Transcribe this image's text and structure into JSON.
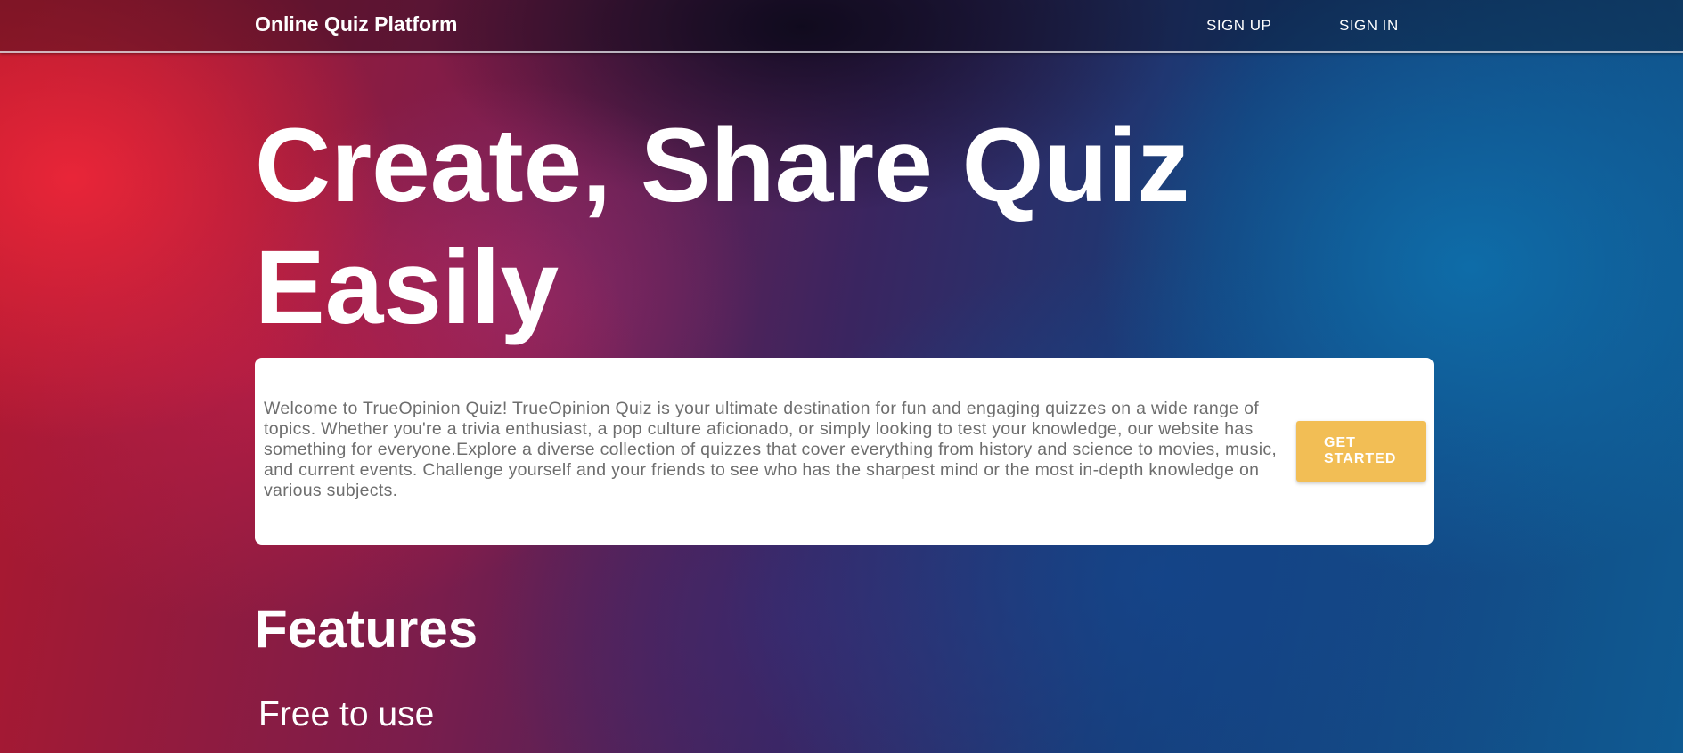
{
  "header": {
    "brand": "Online Quiz Platform",
    "nav": {
      "sign_up": "SIGN UP",
      "sign_in": "SIGN IN"
    }
  },
  "hero": {
    "title": "Create, Share Quiz Easily"
  },
  "intro": {
    "text": "Welcome to TrueOpinion Quiz! TrueOpinion Quiz is your ultimate destination for fun and engaging quizzes on a wide range of topics. Whether you're a trivia enthusiast, a pop culture aficionado, or simply looking to test your knowledge, our website has something for everyone.Explore a diverse collection of quizzes that cover everything from history and science to movies, music, and current events. Challenge yourself and your friends to see who has the sharpest mind or the most in-depth knowledge on various subjects.",
    "cta": {
      "line1": "GET",
      "line2": "STARTED"
    }
  },
  "features": {
    "heading": "Features",
    "items": [
      "Free to use"
    ]
  },
  "colors": {
    "cta_background": "#f2be55",
    "intro_text": "#6e6e6e",
    "card_background": "#ffffff"
  }
}
